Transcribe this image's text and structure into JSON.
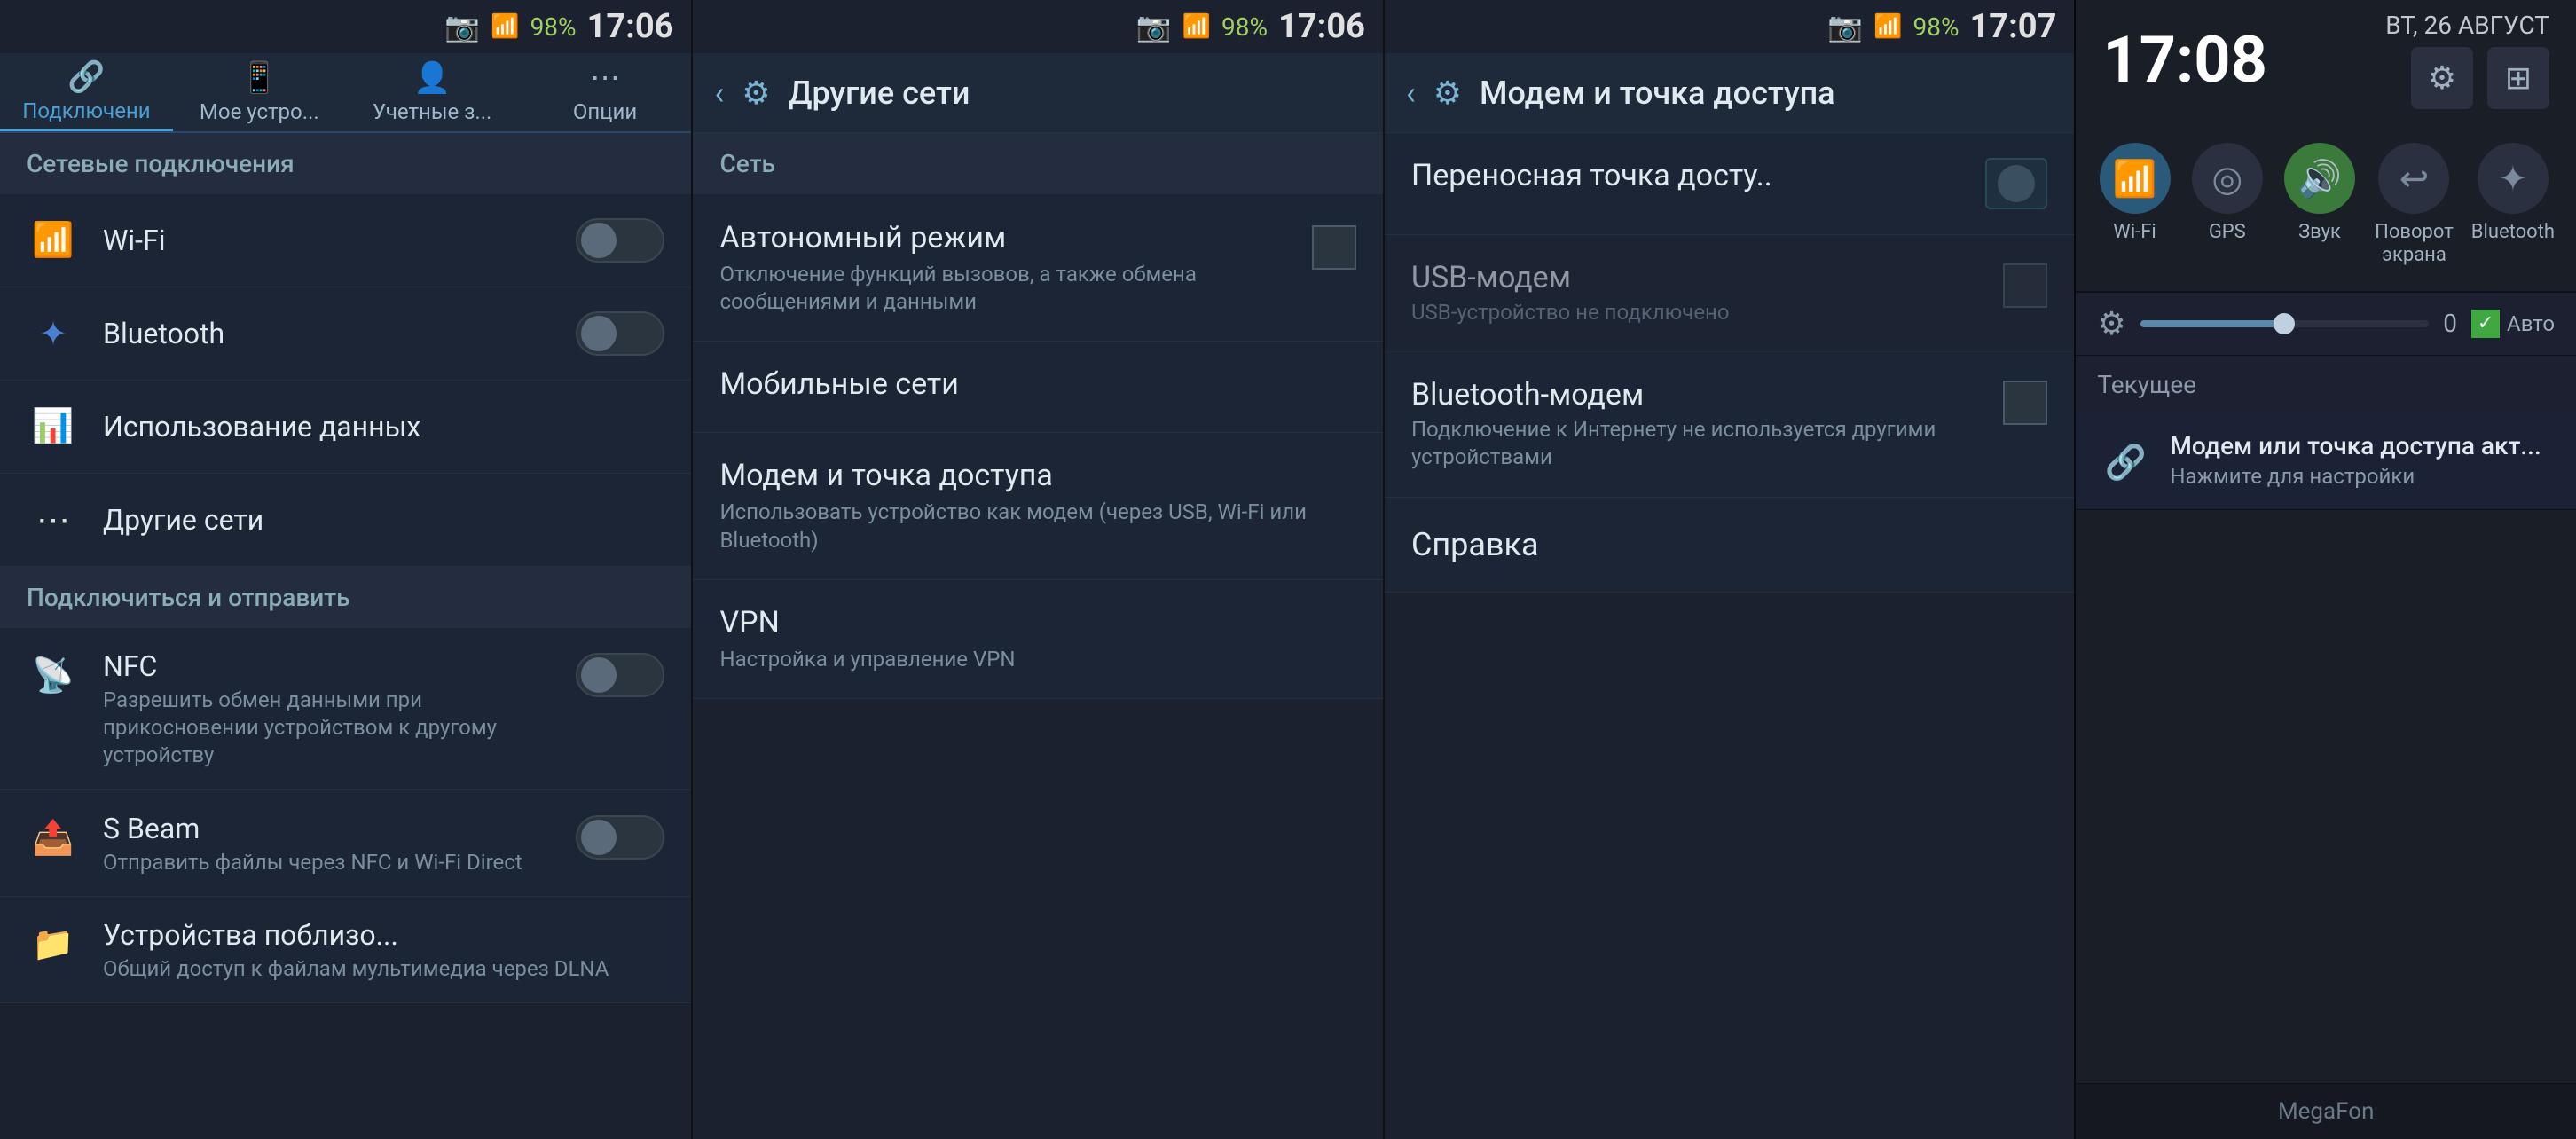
{
  "panels": {
    "panel1": {
      "statusBar": {
        "signal": "▲▲▲",
        "battery": "98%",
        "time": "17:06",
        "cameraIcon": "📷"
      },
      "tabs": [
        {
          "id": "connections",
          "label": "Подключени",
          "icon": "🔗"
        },
        {
          "id": "mydevice",
          "label": "Мое устро...",
          "icon": "📱"
        },
        {
          "id": "accounts",
          "label": "Учетные з...",
          "icon": "👤"
        },
        {
          "id": "options",
          "label": "Опции",
          "icon": "⋯"
        }
      ],
      "sectionLabel": "Сетевые подключения",
      "items": [
        {
          "id": "wifi",
          "icon": "📶",
          "title": "Wi-Fi",
          "hasToggle": true
        },
        {
          "id": "bluetooth",
          "icon": "🔵",
          "title": "Bluetooth",
          "hasToggle": true
        },
        {
          "id": "datausage",
          "icon": "📊",
          "title": "Использование данных",
          "hasToggle": false
        },
        {
          "id": "othernets",
          "icon": "⋯",
          "title": "Другие сети",
          "hasToggle": false
        }
      ],
      "section2Label": "Подключиться и отправить",
      "items2": [
        {
          "id": "nfc",
          "icon": "📡",
          "title": "NFC",
          "desc": "Разрешить обмен данными при прикосновении устройством к другому устройству",
          "hasToggle": true
        },
        {
          "id": "sbeam",
          "icon": "📤",
          "title": "S Beam",
          "desc": "Отправить файлы через NFC и Wi-Fi Direct",
          "hasToggle": true
        },
        {
          "id": "nearbydevices",
          "icon": "📁",
          "title": "Устройства поблизо...",
          "desc": "Общий доступ к файлам мультимедиа через DLNA",
          "hasToggle": false
        }
      ]
    },
    "panel2": {
      "statusBar": {
        "signal": "▲▲▲",
        "battery": "98%",
        "time": "17:06",
        "cameraIcon": "📷"
      },
      "headerBackLabel": "‹",
      "headerTitle": "Другие сети",
      "sectionLabel": "Сеть",
      "items": [
        {
          "id": "autonomous",
          "title": "Автономный режим",
          "desc": "Отключение функций вызовов, а также обмена сообщениями и данными",
          "hasCheckbox": true
        },
        {
          "id": "mobilenets",
          "title": "Мобильные сети",
          "desc": "",
          "hasCheckbox": false
        },
        {
          "id": "modemhotspot",
          "title": "Модем и точка доступа",
          "desc": "Использовать устройство как модем (через USB, Wi-Fi или Bluetooth)",
          "hasCheckbox": false
        },
        {
          "id": "vpn",
          "title": "VPN",
          "desc": "Настройка и управление VPN",
          "hasCheckbox": false
        }
      ]
    },
    "panel3": {
      "statusBar": {
        "signal": "▲▲▲",
        "battery": "98%",
        "time": "17:07",
        "cameraIcon": "📷"
      },
      "headerBackLabel": "‹",
      "headerTitle": "Модем и точка доступа",
      "items": [
        {
          "id": "hotspot",
          "title": "Переносная точка досту..",
          "desc": "",
          "hasToggle": true,
          "toggleOn": false
        },
        {
          "id": "usbmodem",
          "title": "USB-модем",
          "desc": "USB-устройство не подключено",
          "hasCheckbox": true,
          "disabled": true
        },
        {
          "id": "btmodem",
          "title": "Bluetooth-модем",
          "desc": "Подключение к Интернету не используется другими устройствами",
          "hasCheckbox": true
        }
      ],
      "справкаLabel": "Справка"
    },
    "panel4": {
      "time": "17:08",
      "date": "ВТ, 26 АВГУСТ",
      "gearIcon": "⚙",
      "gridIcon": "⊞",
      "quickTiles": [
        {
          "id": "wifi",
          "icon": "📶",
          "label": "Wi-Fi",
          "active": true
        },
        {
          "id": "gps",
          "icon": "◎",
          "label": "GPS",
          "active": false
        },
        {
          "id": "sound",
          "icon": "🔊",
          "label": "Звук",
          "active": true
        },
        {
          "id": "rotate",
          "icon": "↩",
          "label": "Поворот\nэкрана",
          "active": false
        },
        {
          "id": "bluetooth",
          "icon": "✦",
          "label": "Bluetooth",
          "active": false
        }
      ],
      "brightnessValue": "0",
      "brightnessAuto": "Авто",
      "currentLabel": "Текущее",
      "notification": {
        "icon": "🔗",
        "title": "Модем или точка доступа акт...",
        "subtitle": "Нажмите для настройки"
      },
      "carrier": "MegaFon"
    }
  }
}
